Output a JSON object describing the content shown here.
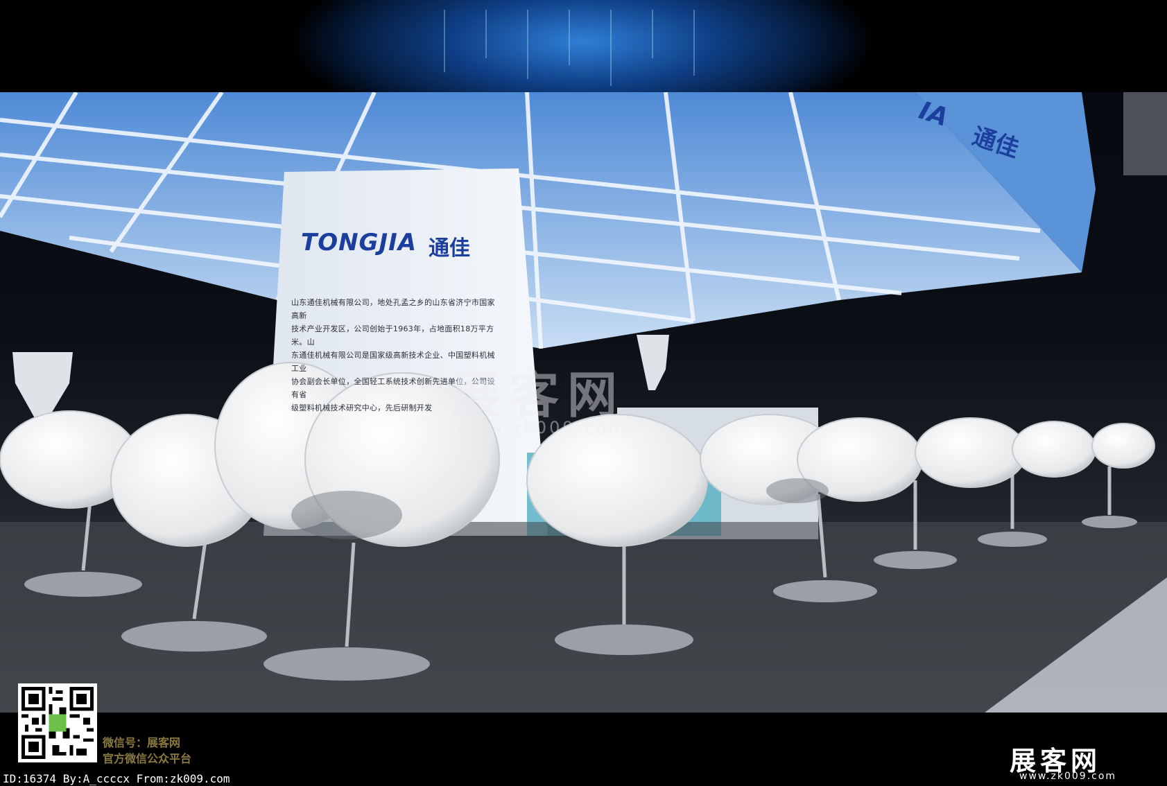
{
  "booth": {
    "logo_latin": "TONGJIA",
    "logo_cn": "通佳",
    "ceiling_logo_latin": "IA",
    "ceiling_logo_cn": "通佳",
    "panel_lines": [
      "山东通佳机械有限公司，地处孔孟之乡的山东省济宁市国家高新",
      "技术产业开发区，公司创始于1963年，占地面积18万平方米。山",
      "东通佳机械有限公司是国家级高新技术企业、中国塑料机械工业",
      "协会副会长单位，全国轻工系统技术创新先进单位，公司设有省",
      "级塑料机械技术研究中心，先后研制开发"
    ]
  },
  "watermark": {
    "cn": "展客网",
    "url": "www.zk009.com"
  },
  "footer": {
    "wechat_id": "微信号：展客网",
    "wechat_platform": "官方微信公众平台",
    "brand_cn": "展客网",
    "brand_url": "www.zk009.com",
    "credit": "ID:16374 By:A_ccccx From:zk009.com"
  },
  "colors": {
    "ceiling_blue": "#3f7fcf",
    "logo_blue": "#1c3f9e",
    "floor_gray": "#3a3f44"
  }
}
